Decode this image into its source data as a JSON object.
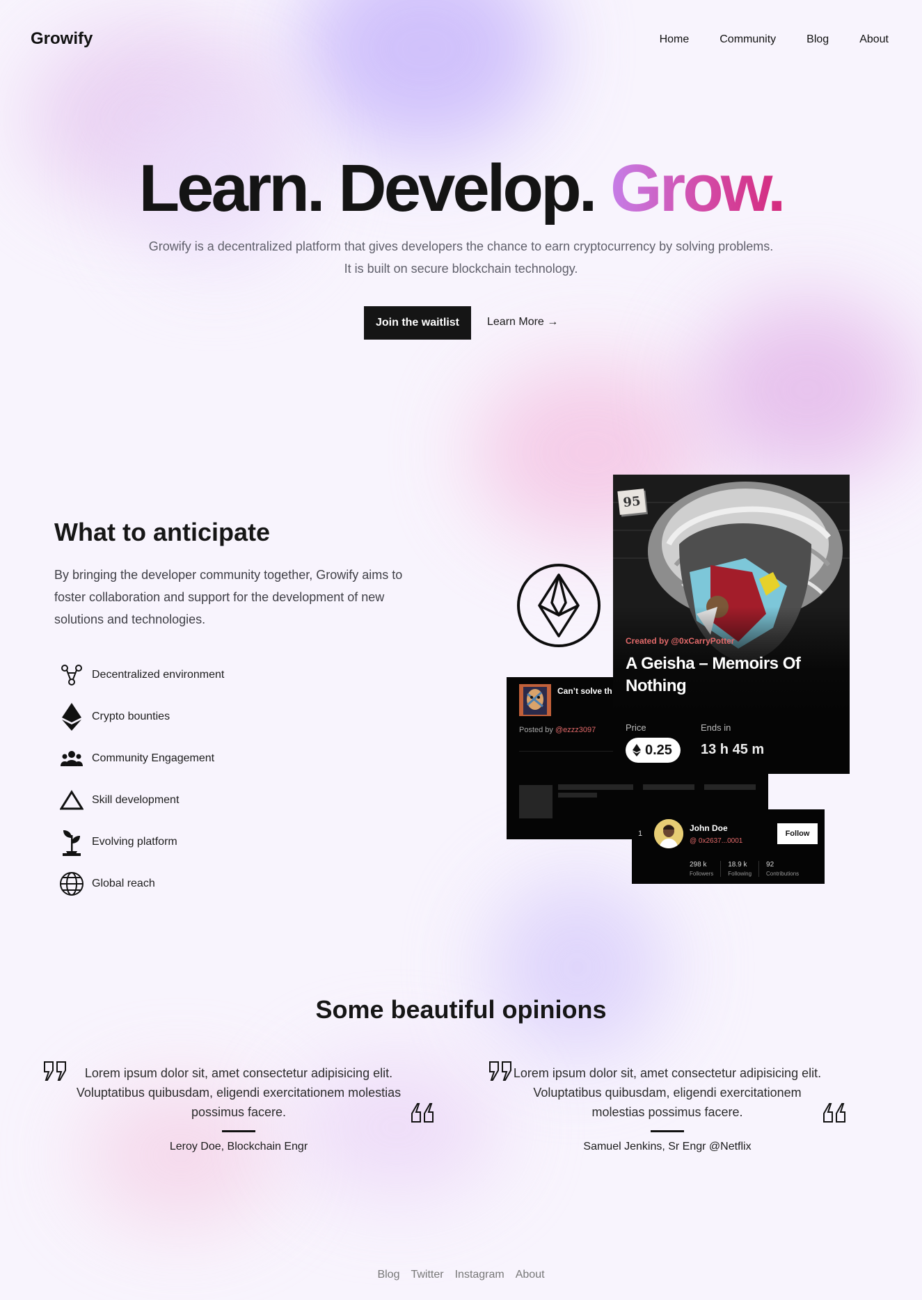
{
  "brand": {
    "name": "Growify"
  },
  "nav": {
    "items": [
      "Home",
      "Community",
      "Blog",
      "About"
    ]
  },
  "hero": {
    "title_part1": "Learn. Develop.",
    "title_part2": "Grow.",
    "subtitle_line1": "Growify is a decentralized platform that gives developers the chance to earn cryptocurrency by solving problems.",
    "subtitle_line2": "It is built on secure blockchain technology.",
    "cta_label": "Join the waitlist",
    "learn_label": "Learn More →"
  },
  "anticipate": {
    "title": "What to anticipate",
    "text": "By bringing the developer community together, Growify aims to foster collaboration and support for the development of new solutions and technologies.",
    "features": [
      {
        "label": "Decentralized environment",
        "icon": "network-icon"
      },
      {
        "label": "Crypto bounties",
        "icon": "ethereum-icon"
      },
      {
        "label": "Community Engagement",
        "icon": "people-icon"
      },
      {
        "label": "Skill development",
        "icon": "triangle-icon"
      },
      {
        "label": "Evolving platform",
        "icon": "plant-icon"
      },
      {
        "label": "Global reach",
        "icon": "globe-icon"
      }
    ]
  },
  "nft_card": {
    "badge": "95",
    "creator": "Created by @0xCarryPotter",
    "title": "A Geisha – Memoirs Of Nothing",
    "price_label": "Price",
    "price_value": "0.25",
    "ends_label": "Ends in",
    "ends_value": "13 h  45 m"
  },
  "post_card": {
    "title": "Can’t solve th issue, it’s a...",
    "posted_by": "Posted by",
    "handle": "@ezzz3097"
  },
  "profile_card": {
    "rank": "1",
    "name": "John Doe",
    "address": "@ 0x2637...0001",
    "follow_label": "Follow",
    "stats": [
      {
        "value": "298 k",
        "label": "Followers"
      },
      {
        "value": "18.9 k",
        "label": "Following"
      },
      {
        "value": "92",
        "label": "Contributions"
      }
    ]
  },
  "opinions": {
    "title": "Some beautiful opinions",
    "items": [
      {
        "text": "Lorem ipsum dolor sit, amet consectetur adipisicing elit. Voluptatibus quibusdam, eligendi exercitationem molestias possimus facere.",
        "author": "Leroy Doe, Blockchain Engr"
      },
      {
        "text": "Lorem ipsum dolor sit, amet consectetur adipisicing elit. Voluptatibus quibusdam, eligendi exercitationem molestias possimus facere.",
        "author": "Samuel Jenkins, Sr Engr @Netflix"
      }
    ]
  },
  "footer": {
    "links": [
      "Blog",
      "Twitter",
      "Instagram",
      "About"
    ]
  },
  "colors": {
    "background": "#f8f4fd",
    "accent_gradient_start": "#c57ee8",
    "accent_gradient_end": "#d42a7d",
    "cta_bg": "#151515",
    "highlight_red": "#e36a6a"
  }
}
